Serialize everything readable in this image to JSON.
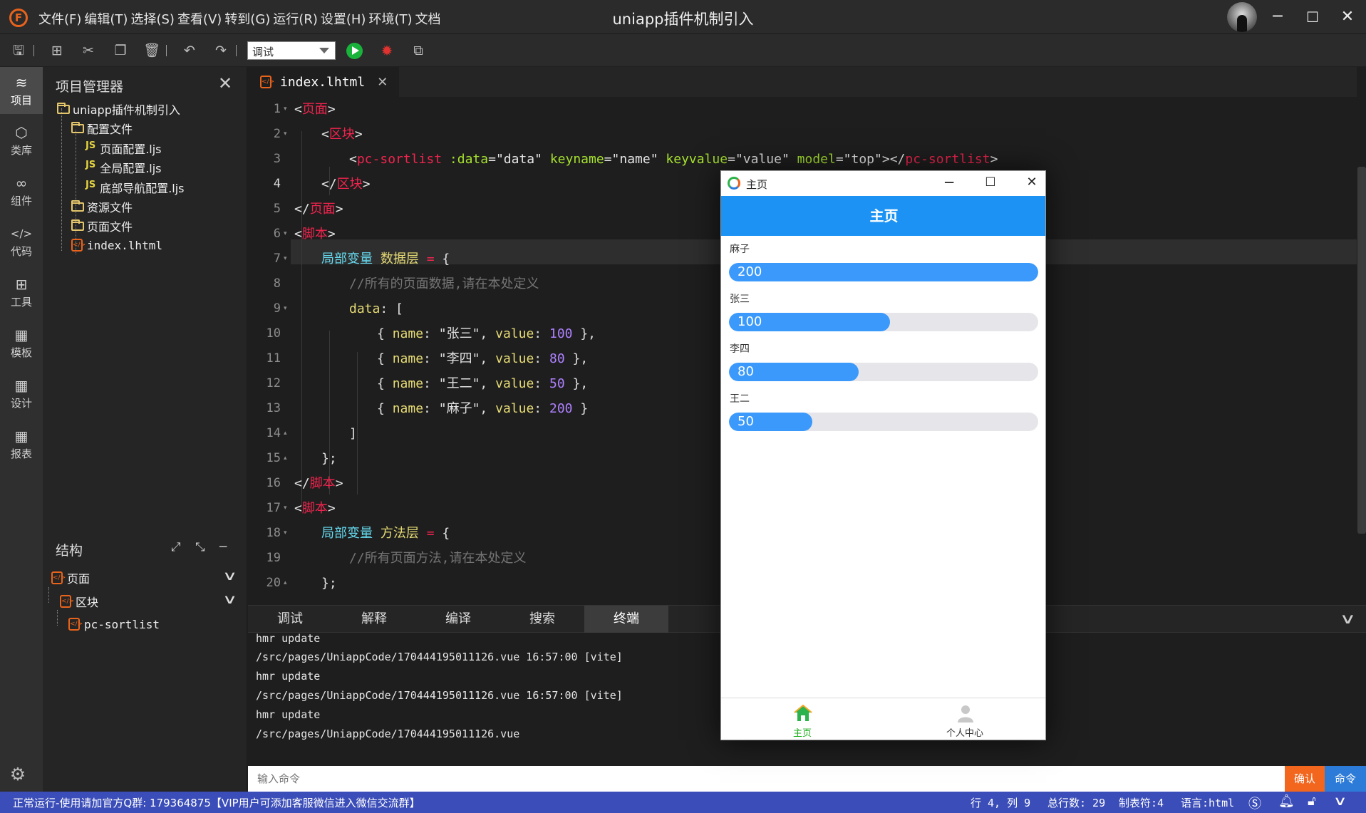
{
  "titlebar": {
    "logo": "F",
    "menu": [
      "文件(F)",
      "编辑(T)",
      "选择(S)",
      "查看(V)",
      "转到(G)",
      "运行(R)",
      "设置(H)",
      "环境(T)",
      "文档"
    ],
    "window_title": "uniapp插件机制引入"
  },
  "toolbar": {
    "run_mode": "调试",
    "icons": [
      "save-icon",
      "new-file-icon",
      "cut-icon",
      "copy-icon",
      "delete-icon",
      "undo-icon",
      "redo-icon",
      "run-icon",
      "debug-icon",
      "preview-icon"
    ]
  },
  "activity": [
    {
      "label": "项目",
      "icon": "layers-icon",
      "glyph": "≋"
    },
    {
      "label": "类库",
      "icon": "cube-icon",
      "glyph": "⬡"
    },
    {
      "label": "组件",
      "icon": "component-icon",
      "glyph": "∞"
    },
    {
      "label": "代码",
      "icon": "code-icon",
      "glyph": "</>"
    },
    {
      "label": "工具",
      "icon": "tools-icon",
      "glyph": "⊞"
    },
    {
      "label": "模板",
      "icon": "template-icon",
      "glyph": "▦"
    },
    {
      "label": "设计",
      "icon": "design-icon",
      "glyph": "▦"
    },
    {
      "label": "报表",
      "icon": "report-icon",
      "glyph": "▦"
    }
  ],
  "explorer": {
    "title": "项目管理器",
    "root": "uniapp插件机制引入",
    "config_folder": "配置文件",
    "files": [
      "页面配置.ljs",
      "全局配置.ljs",
      "底部导航配置.ljs"
    ],
    "res_folder": "资源文件",
    "page_folder": "页面文件",
    "index_file": "index.lhtml"
  },
  "structure": {
    "title": "结构",
    "nodes": [
      "页面",
      "区块",
      "pc-sortlist"
    ]
  },
  "editor": {
    "tab_label": "index.lhtml",
    "lines": [
      "1",
      "2",
      "3",
      "4",
      "5",
      "6",
      "7",
      "8",
      "9",
      "10",
      "11",
      "12",
      "13",
      "14",
      "15",
      "16",
      "17",
      "18",
      "19",
      "20"
    ],
    "code": {
      "l1_tag": "页面",
      "l2_tag": "区块",
      "l3_tag": "pc-sortlist",
      "l3_attr1": ":data",
      "l3_val1": "\"data\"",
      "l3_attr2": "keyname",
      "l3_val2": "\"name\"",
      "l3_attr3": "keyvalue",
      "l3_val3": "\"value\"",
      "l3_attr4": "model",
      "l3_val4": "\"top\"",
      "l4_tag": "区块",
      "l5_tag": "页面",
      "l6_tag": "脚本",
      "l7_kw": "局部变量",
      "l7_name": "数据层",
      "l8_comment": "//所有的页面数据,请在本处定义",
      "l9_prop": "data",
      "rows": [
        {
          "name": "\"张三\"",
          "value": "100",
          "tail": " },"
        },
        {
          "name": "\"李四\"",
          "value": "80",
          "tail": " },"
        },
        {
          "name": "\"王二\"",
          "value": "50",
          "tail": " },"
        },
        {
          "name": "\"麻子\"",
          "value": "200",
          "tail": " }"
        }
      ],
      "l16_tag": "脚本",
      "l17_tag": "脚本",
      "l18_kw": "局部变量",
      "l18_name": "方法层",
      "l19_comment": "//所有页面方法,请在本处定义"
    }
  },
  "panel": {
    "tabs": [
      "调试",
      "解释",
      "编译",
      "搜索",
      "终端"
    ],
    "active_tab": "终端",
    "terminal": [
      "hmr update",
      "/src/pages/UniappCode/170444195011126.vue 16:57:00 [vite]",
      "hmr update",
      "/src/pages/UniappCode/170444195011126.vue 16:57:00 [vite]",
      "hmr update",
      "/src/pages/UniappCode/170444195011126.vue"
    ]
  },
  "command": {
    "placeholder": "输入命令",
    "confirm": "确认",
    "cmd": "命令"
  },
  "status": {
    "left": "正常运行-使用请加官方Q群: 179364875【VIP用户可添加客服微信进入微信交流群】",
    "position": "行 4, 列 9",
    "total_lines": "总行数: 29",
    "tab_size": "制表符:4",
    "language": "语言:html"
  },
  "preview": {
    "window_title": "主页",
    "header": "主页",
    "items": [
      {
        "label": "麻子",
        "value": 200,
        "fraction": 1.0
      },
      {
        "label": "张三",
        "value": 100,
        "fraction": 0.52
      },
      {
        "label": "李四",
        "value": 80,
        "fraction": 0.42
      },
      {
        "label": "王二",
        "value": 50,
        "fraction": 0.27
      }
    ],
    "tabbar": [
      {
        "label": "主页",
        "color": "#1aad19"
      },
      {
        "label": "个人中心",
        "color": "#333333"
      }
    ]
  }
}
